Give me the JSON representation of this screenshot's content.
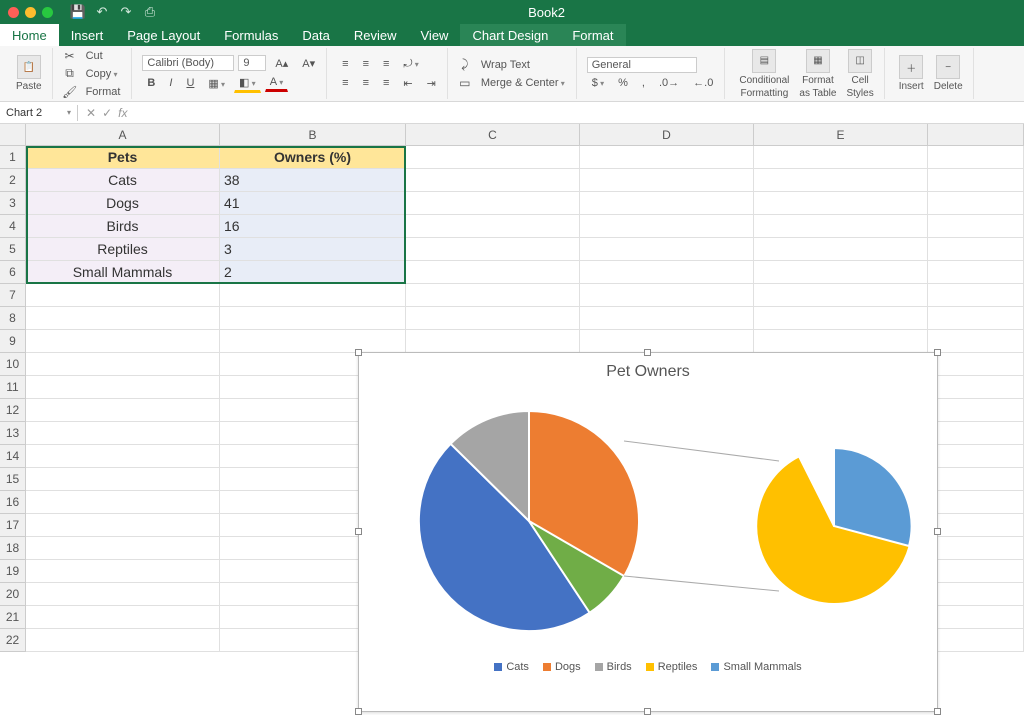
{
  "window": {
    "title": "Book2"
  },
  "tabs": {
    "home": "Home",
    "insert": "Insert",
    "pagelayout": "Page Layout",
    "formulas": "Formulas",
    "data": "Data",
    "review": "Review",
    "view": "View",
    "chartdesign": "Chart Design",
    "format": "Format"
  },
  "ribbon": {
    "paste": "Paste",
    "cut": "Cut",
    "copy": "Copy",
    "format": "Format",
    "font_name": "Calibri (Body)",
    "font_size": "9",
    "wrap": "Wrap Text",
    "merge": "Merge & Center",
    "numfmt": "General",
    "cond": "Conditional",
    "cond2": "Formatting",
    "ftbl": "Format",
    "ftbl2": "as Table",
    "cstyle": "Cell",
    "cstyle2": "Styles",
    "insert": "Insert",
    "delete": "Delete"
  },
  "namebox": "Chart 2",
  "formula_bar": "",
  "columns": [
    "A",
    "B",
    "C",
    "D",
    "E"
  ],
  "rows": [
    1,
    2,
    3,
    4,
    5,
    6,
    7,
    8,
    9,
    10,
    11,
    12,
    13,
    14,
    15,
    16,
    17,
    18,
    19,
    20,
    21,
    22
  ],
  "table": {
    "headerA": "Pets",
    "headerB": "Owners (%)",
    "rows": [
      {
        "a": "Cats",
        "b": "38"
      },
      {
        "a": "Dogs",
        "b": "41"
      },
      {
        "a": "Birds",
        "b": "16"
      },
      {
        "a": "Reptiles",
        "b": "3"
      },
      {
        "a": "Small Mammals",
        "b": "2"
      }
    ]
  },
  "chart": {
    "title": "Pet Owners",
    "legend": [
      "Cats",
      "Dogs",
      "Birds",
      "Reptiles",
      "Small Mammals"
    ],
    "colors": {
      "cats": "#4472c4",
      "dogs": "#ed7d31",
      "birds": "#a5a5a5",
      "reptiles": "#ffc000",
      "mammals": "#5b9bd5",
      "other": "#70ad47"
    }
  },
  "chart_data": {
    "type": "pie",
    "title": "Pet Owners",
    "subtype": "pie-of-pie",
    "categories": [
      "Cats",
      "Dogs",
      "Birds",
      "Reptiles",
      "Small Mammals"
    ],
    "values": [
      38,
      41,
      16,
      3,
      2
    ],
    "secondary_plot_categories": [
      "Birds",
      "Reptiles",
      "Small Mammals"
    ],
    "secondary_plot_values": [
      16,
      3,
      2
    ],
    "legend_position": "bottom"
  }
}
